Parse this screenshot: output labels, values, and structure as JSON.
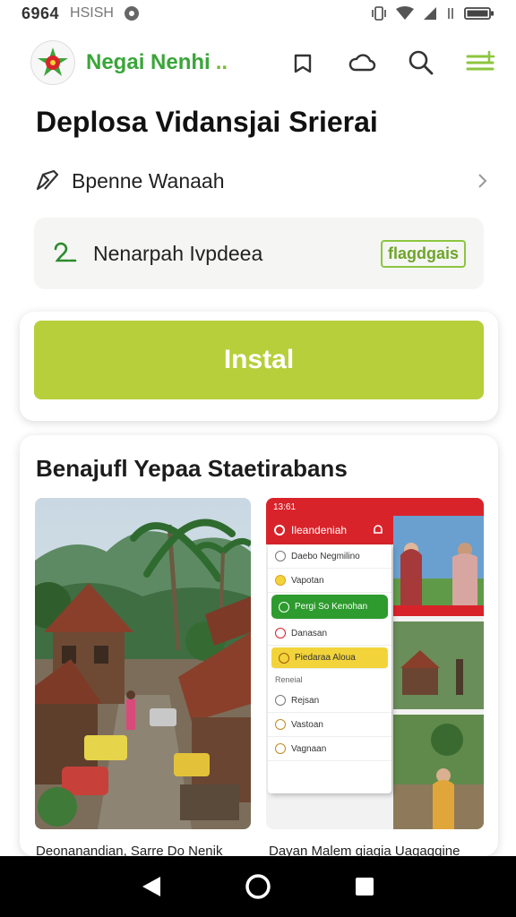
{
  "status_bar": {
    "time": "6964",
    "carrier": "HSISH"
  },
  "app_bar": {
    "title": "Negai Nenhi",
    "title_suffix": "..",
    "icons": [
      "bookmark-icon",
      "cloud-icon",
      "search-icon",
      "menu-icon"
    ]
  },
  "app": {
    "name": "Deplosa Vidansjai Srierai",
    "author": "Bpenne Wanaah",
    "info_text": "Nenarpah Ivpdeea",
    "info_badge": "flagdgais"
  },
  "install": {
    "label": "Instal"
  },
  "screenshots": {
    "title": "Benajufl Yepaa Staetirabans",
    "captions": [
      "Deonanandian, Sarre Do Nenik",
      "Dayan Malem giagia Uagagqine"
    ]
  },
  "mini_app": {
    "status_time": "13:61",
    "title": "Ileandeniah",
    "menu_items": [
      "Daebo Negmilino",
      "Vapotan",
      "Pergi So Kenohan",
      "Danasan",
      "Piedaraa Aloua",
      "Reneial",
      "Rejsan",
      "Vastoan",
      "Vagnaan"
    ]
  },
  "colors": {
    "accent_green": "#3aa53a",
    "install_button": "#b7cf3a",
    "mini_app_red": "#d9232a"
  }
}
